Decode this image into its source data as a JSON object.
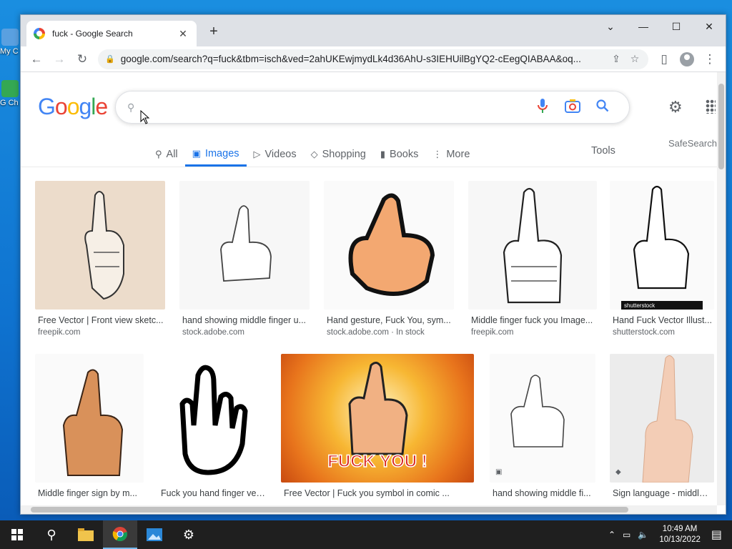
{
  "desktop": {
    "icons": [
      {
        "label": "My C",
        "color": "#5aa0e0"
      },
      {
        "label": "G Ch",
        "color": "#34a853"
      }
    ]
  },
  "browser": {
    "tab_title": "fuck - Google Search",
    "url": "google.com/search?q=fuck&tbm=isch&ved=2ahUKEwjmydLk4d36AhU-s3IEHUilBgYQ2-cEegQIABAA&oq..."
  },
  "google": {
    "logo_letters": [
      "G",
      "o",
      "o",
      "g",
      "l",
      "e"
    ],
    "search_value": "",
    "search_placeholder": "",
    "safesearch": "SafeSearch",
    "tools": "Tools",
    "tabs": [
      {
        "label": "All",
        "icon": "search-icon",
        "active": false
      },
      {
        "label": "Images",
        "icon": "image-icon",
        "active": true
      },
      {
        "label": "Videos",
        "icon": "video-icon",
        "active": false
      },
      {
        "label": "Shopping",
        "icon": "tag-icon",
        "active": false
      },
      {
        "label": "Books",
        "icon": "book-icon",
        "active": false
      },
      {
        "label": "More",
        "icon": "more-dots-icon",
        "active": false
      }
    ]
  },
  "results": [
    {
      "title": "Free Vector | Front view sketc...",
      "source": "freepik.com"
    },
    {
      "title": "hand showing middle finger u...",
      "source": "stock.adobe.com"
    },
    {
      "title": "Hand gesture, Fuck You, sym...",
      "source": "stock.adobe.com · In stock"
    },
    {
      "title": "Middle finger fuck you Image...",
      "source": "freepik.com"
    },
    {
      "title": "Hand Fuck Vector Illust...",
      "source": "shutterstock.com"
    },
    {
      "title": "Middle finger sign by m...",
      "source": ""
    },
    {
      "title": "Fuck you hand finger vec...",
      "source": ""
    },
    {
      "title": "Free Vector | Fuck you symbol in comic ...",
      "source": ""
    },
    {
      "title": "hand showing middle fi...",
      "source": ""
    },
    {
      "title": "Sign language - middle ...",
      "source": ""
    }
  ],
  "thumb_text": {
    "shutterstock": "shutterstock",
    "fuck_you": "FUCK YOU !"
  },
  "taskbar": {
    "time": "10:49 AM",
    "date": "10/13/2022"
  },
  "colors": {
    "accent": "#1a73e8",
    "taskbar": "#1f1f1f"
  }
}
